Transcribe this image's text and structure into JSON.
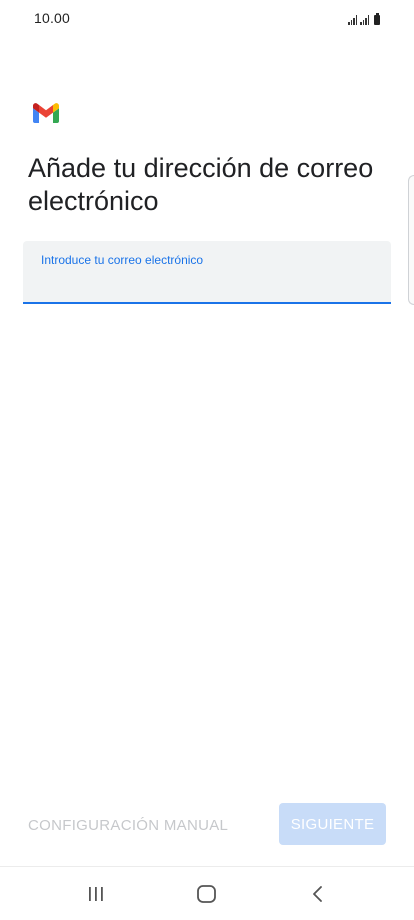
{
  "status_bar": {
    "time": "10.00"
  },
  "app": {
    "logo_icon": "gmail-logo"
  },
  "page": {
    "title": "Añade tu dirección de correo electrónico"
  },
  "email_field": {
    "label": "Introduce tu correo electrónico",
    "value": ""
  },
  "actions": {
    "manual_config_label": "CONFIGURACIÓN MANUAL",
    "next_label": "SIGUIENTE"
  },
  "nav_bar": {
    "recents_icon": "recent-apps-icon",
    "home_icon": "home-icon",
    "back_icon": "back-icon"
  },
  "colors": {
    "accent": "#1a73e8",
    "next_button_disabled": "#c8dcf8",
    "manual_disabled_text": "#c6c8cb",
    "field_background": "#f1f3f4"
  }
}
